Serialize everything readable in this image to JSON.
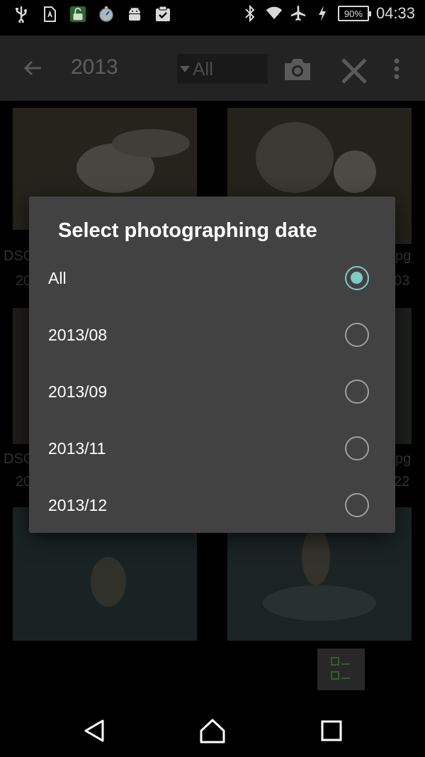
{
  "status_bar": {
    "time": "04:33",
    "battery": "90%",
    "left_icons": [
      "usb-icon",
      "sim-card-icon",
      "unlock-icon",
      "timer-icon",
      "android-icon",
      "clipboard-check-icon"
    ],
    "right_icons": [
      "bluetooth-icon",
      "wifi-icon",
      "airplane-icon",
      "charging-icon"
    ]
  },
  "app_bar": {
    "title": "2013",
    "filter_value": "All",
    "icons": [
      "back-arrow-icon",
      "camera-icon",
      "close-icon",
      "more-vert-icon"
    ]
  },
  "grid": {
    "captions": [
      {
        "left": "DSC",
        "right": "pg"
      },
      {
        "left": "20",
        "right": "03"
      },
      {
        "left": "DSC",
        "right": "pg"
      },
      {
        "left": "20",
        "right": "22"
      }
    ]
  },
  "dialog": {
    "title": "Select photographing date",
    "options": [
      {
        "label": "All",
        "checked": true
      },
      {
        "label": "2013/08",
        "checked": false
      },
      {
        "label": "2013/09",
        "checked": false
      },
      {
        "label": "2013/11",
        "checked": false
      },
      {
        "label": "2013/12",
        "checked": false
      }
    ],
    "accent_color": "#80cbc4"
  },
  "nav_bar": {
    "buttons": [
      "back-triangle-icon",
      "home-icon",
      "recents-square-icon"
    ]
  }
}
